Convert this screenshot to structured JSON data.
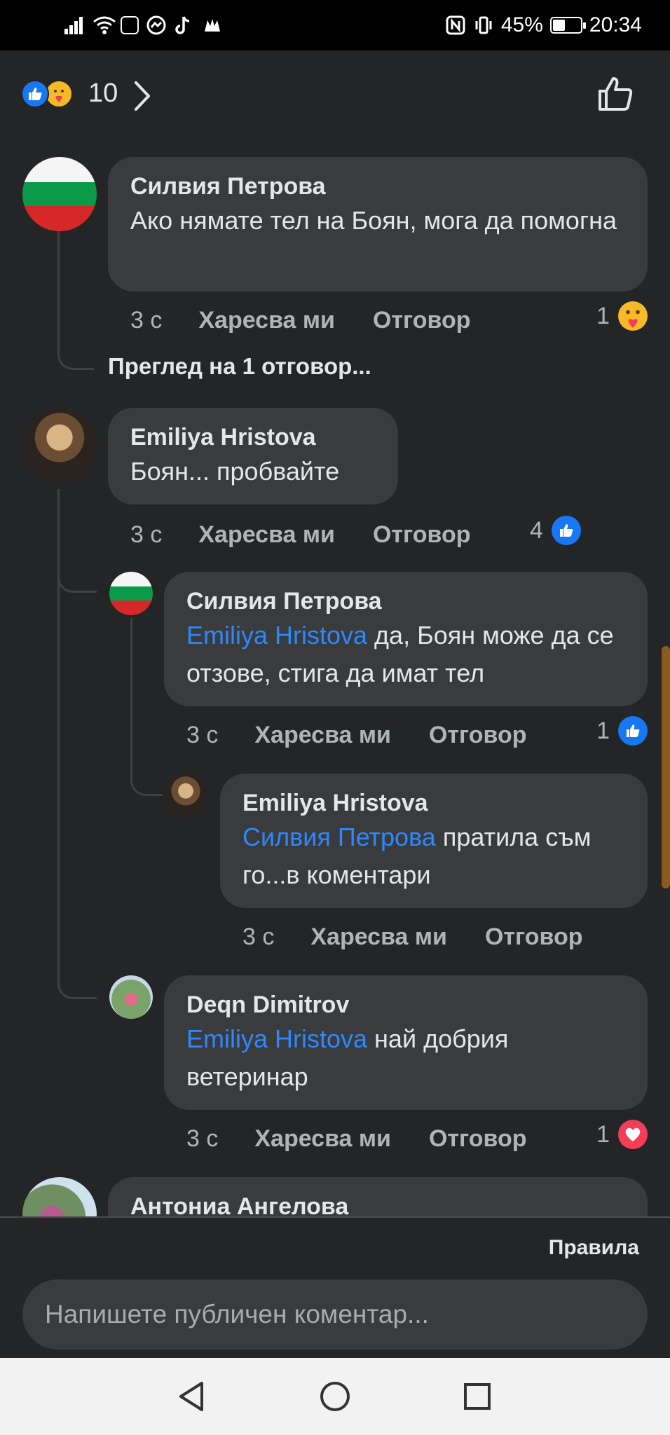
{
  "status_bar": {
    "battery_text": "45%",
    "battery_level": 0.45,
    "time": "20:34"
  },
  "reactions_header": {
    "count": "10",
    "icons": [
      "like-icon",
      "care-icon"
    ]
  },
  "comments": [
    {
      "author": "Силвия Петрова",
      "text": "Ако нямате тел на Боян, мога да помогна",
      "time": "3 с",
      "like_label": "Харесва ми",
      "reply_label": "Отговор",
      "reaction_count": "1",
      "reaction_icon": "care-icon",
      "view_replies": "Преглед на 1 отговор..."
    },
    {
      "author": "Emiliya Hristova",
      "text": "Боян... пробвайте",
      "time": "3 с",
      "like_label": "Харесва ми",
      "reply_label": "Отговор",
      "reaction_count": "4",
      "reaction_icon": "like-icon",
      "replies": [
        {
          "author": "Силвия Петрова",
          "mention": "Emiliya Hristova",
          "text": " да, Боян може да се отзове, стига да имат тел",
          "time": "3 с",
          "like_label": "Харесва ми",
          "reply_label": "Отговор",
          "reaction_count": "1",
          "reaction_icon": "like-icon",
          "replies": [
            {
              "author": "Emiliya Hristova",
              "mention": "Силвия Петрова",
              "text": " пратила съм го...в коментари",
              "time": "3 с",
              "like_label": "Харесва ми",
              "reply_label": "Отговор"
            }
          ]
        },
        {
          "author": "Deqn Dimitrov",
          "mention": "Emiliya Hristova",
          "text": " най добрия ветеринар",
          "time": "3 с",
          "like_label": "Харесва ми",
          "reply_label": "Отговор",
          "reaction_count": "1",
          "reaction_icon": "love-icon"
        }
      ]
    },
    {
      "author": "Антониа Ангелова"
    }
  ],
  "composer": {
    "rules_label": "Правила",
    "placeholder": "Напишете публичен коментар..."
  },
  "colors": {
    "background": "#242526",
    "bubble": "#3a3b3c",
    "mention": "#2d88ff",
    "like_blue": "#1877f2",
    "love_red": "#f33e58",
    "care_yellow": "#f7b928"
  }
}
